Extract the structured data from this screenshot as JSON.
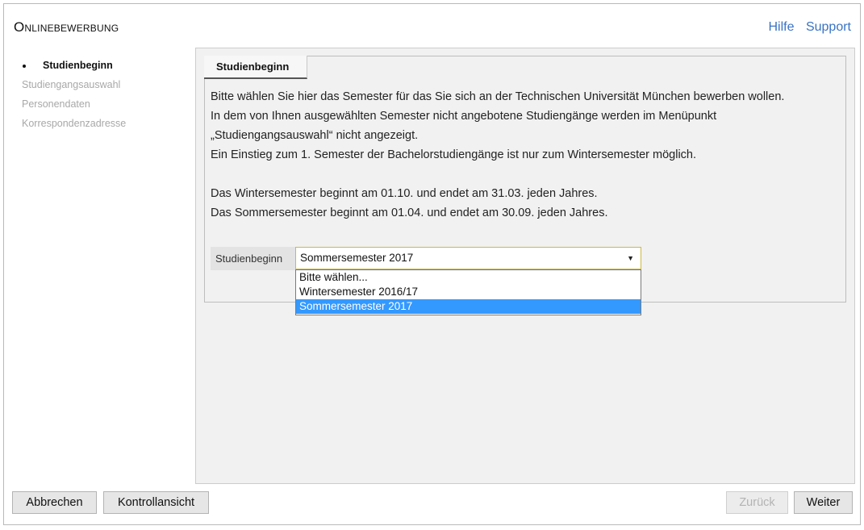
{
  "app": {
    "title": "Onlinebewerbung"
  },
  "top_links": {
    "help": "Hilfe",
    "support": "Support"
  },
  "sidebar": {
    "items": [
      {
        "label": "Studienbeginn"
      },
      {
        "label": "Studiengangsauswahl"
      },
      {
        "label": "Personendaten"
      },
      {
        "label": "Korrespondenzadresse"
      }
    ]
  },
  "main": {
    "tab": "Studienbeginn",
    "description": {
      "line1": "Bitte wählen Sie hier das Semester für das Sie sich an der Technischen Universität München bewerben wollen.",
      "line2": "In dem von Ihnen ausgewählten Semester nicht angebotene Studiengänge werden im Menüpunkt",
      "line3": "„Studiengangsauswahl“ nicht angezeigt.",
      "line4": "Ein Einstieg zum 1. Semester der Bachelorstudiengänge ist nur zum Wintersemester möglich.",
      "line5": "Das Wintersemester beginnt am 01.10. und endet am 31.03. jeden Jahres.",
      "line6": "Das Sommersemester beginnt am 01.04. und endet am 30.09. jeden Jahres."
    },
    "field": {
      "label": "Studienbeginn",
      "selected": "Sommersemester 2017",
      "options": [
        "Bitte wählen...",
        "Wintersemester 2016/17",
        "Sommersemester 2017"
      ]
    }
  },
  "footer": {
    "cancel": "Abbrechen",
    "review": "Kontrollansicht",
    "back": "Zurück",
    "next": "Weiter"
  },
  "colors": {
    "link": "#3a73c4",
    "selection": "#3399ff"
  }
}
